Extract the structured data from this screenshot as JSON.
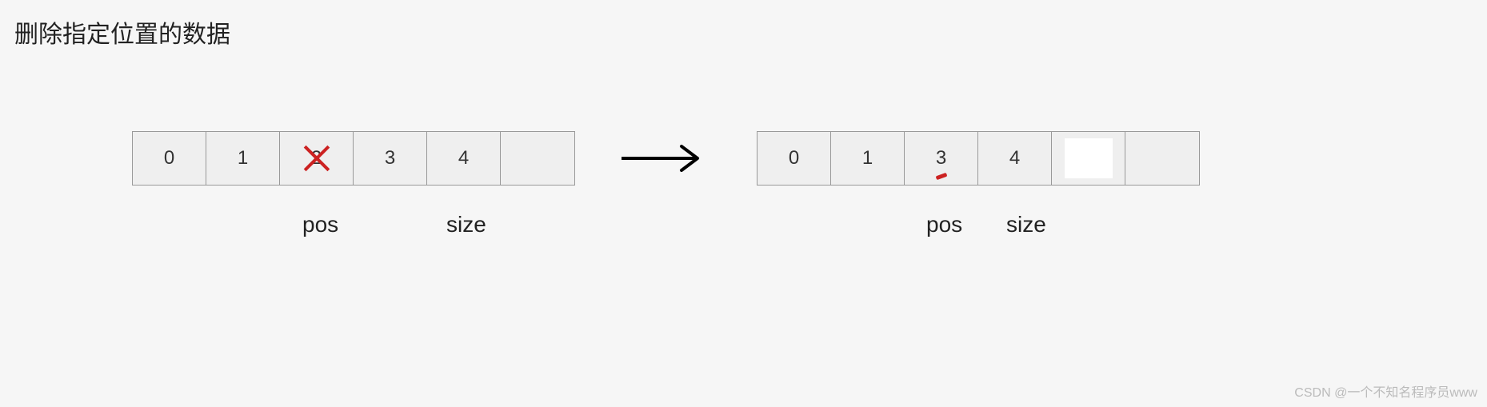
{
  "title": "删除指定位置的数据",
  "chart_data": {
    "type": "table",
    "before": {
      "cells": [
        "0",
        "1",
        "2",
        "3",
        "4",
        ""
      ],
      "deleted_index": 2
    },
    "after": {
      "cells": [
        "0",
        "1",
        "3",
        "4",
        "",
        ""
      ]
    },
    "labels": {
      "pos": "pos",
      "size": "size"
    }
  },
  "left_array": {
    "c0": "0",
    "c1": "1",
    "c2": "2",
    "c3": "3",
    "c4": "4",
    "c5": ""
  },
  "right_array": {
    "c0": "0",
    "c1": "1",
    "c2": "3",
    "c3": "4",
    "c4": "",
    "c5": ""
  },
  "labels": {
    "pos": "pos",
    "size": "size"
  },
  "watermark": "CSDN @一个不知名程序员www"
}
